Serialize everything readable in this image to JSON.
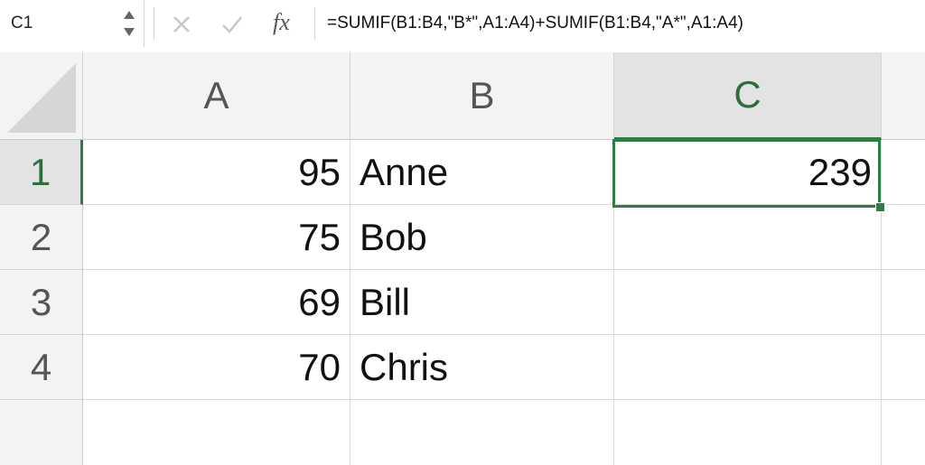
{
  "formula_bar": {
    "name_box": "C1",
    "fx_label": "fx",
    "formula": "=SUMIF(B1:B4,\"B*\",A1:A4)+SUMIF(B1:B4,\"A*\",A1:A4)",
    "cancel_icon": "close-icon",
    "confirm_icon": "check-icon"
  },
  "sheet": {
    "active_cell": "C1",
    "columns": [
      "A",
      "B",
      "C"
    ],
    "rows": [
      "1",
      "2",
      "3",
      "4"
    ],
    "cells": {
      "A1": "95",
      "B1": "Anne",
      "C1": "239",
      "A2": "75",
      "B2": "Bob",
      "C2": "",
      "A3": "69",
      "B3": "Bill",
      "C3": "",
      "A4": "70",
      "B4": "Chris",
      "C4": ""
    }
  },
  "colors": {
    "accent": "#2e7d44",
    "header_bg": "#f3f3f3",
    "active_header_bg": "#e3e3e3"
  }
}
